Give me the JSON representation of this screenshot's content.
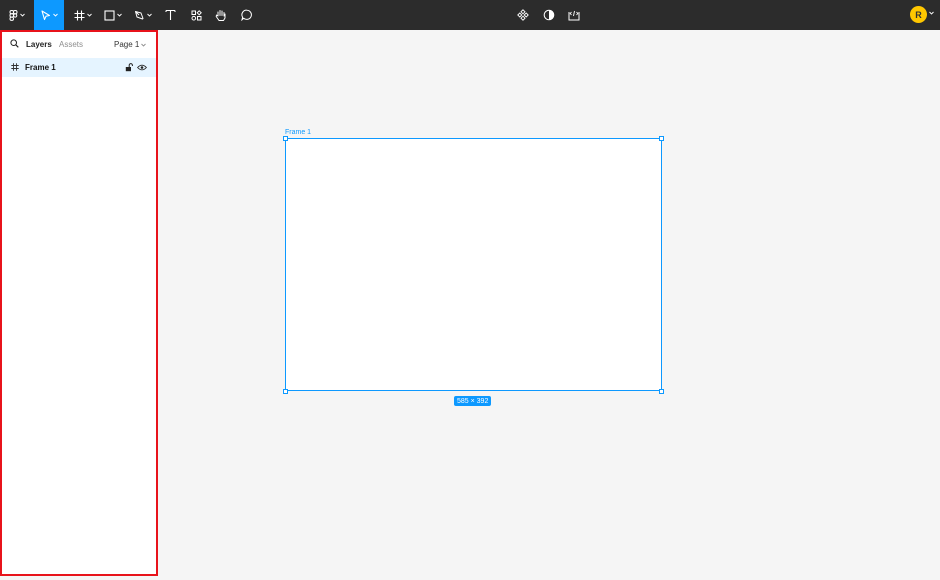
{
  "toolbar": {
    "tools": [
      {
        "name": "main-menu",
        "icon": "figma-logo-icon"
      },
      {
        "name": "move-tool",
        "icon": "cursor-icon",
        "active": true
      },
      {
        "name": "frame-tool",
        "icon": "hash-icon"
      },
      {
        "name": "shape-tool",
        "icon": "rectangle-icon"
      },
      {
        "name": "pen-tool",
        "icon": "pen-icon"
      },
      {
        "name": "text-tool",
        "icon": "text-icon"
      },
      {
        "name": "resources-tool",
        "icon": "resources-icon"
      },
      {
        "name": "hand-tool",
        "icon": "hand-icon"
      },
      {
        "name": "comment-tool",
        "icon": "comment-icon"
      }
    ],
    "center_tools": [
      {
        "name": "components",
        "icon": "component-icon"
      },
      {
        "name": "contrast",
        "icon": "contrast-icon"
      },
      {
        "name": "dev-mode",
        "icon": "code-icon"
      }
    ],
    "avatar_initial": "R",
    "accent_color": "#0d99ff",
    "avatar_color": "#ffc700"
  },
  "panel": {
    "tab_layers": "Layers",
    "tab_assets": "Assets",
    "page_label": "Page 1",
    "layers": [
      {
        "label": "Frame 1",
        "selected": true
      }
    ],
    "highlight_color": "#e8131b"
  },
  "canvas": {
    "frame_name": "Frame 1",
    "size_label": "585 × 392"
  }
}
